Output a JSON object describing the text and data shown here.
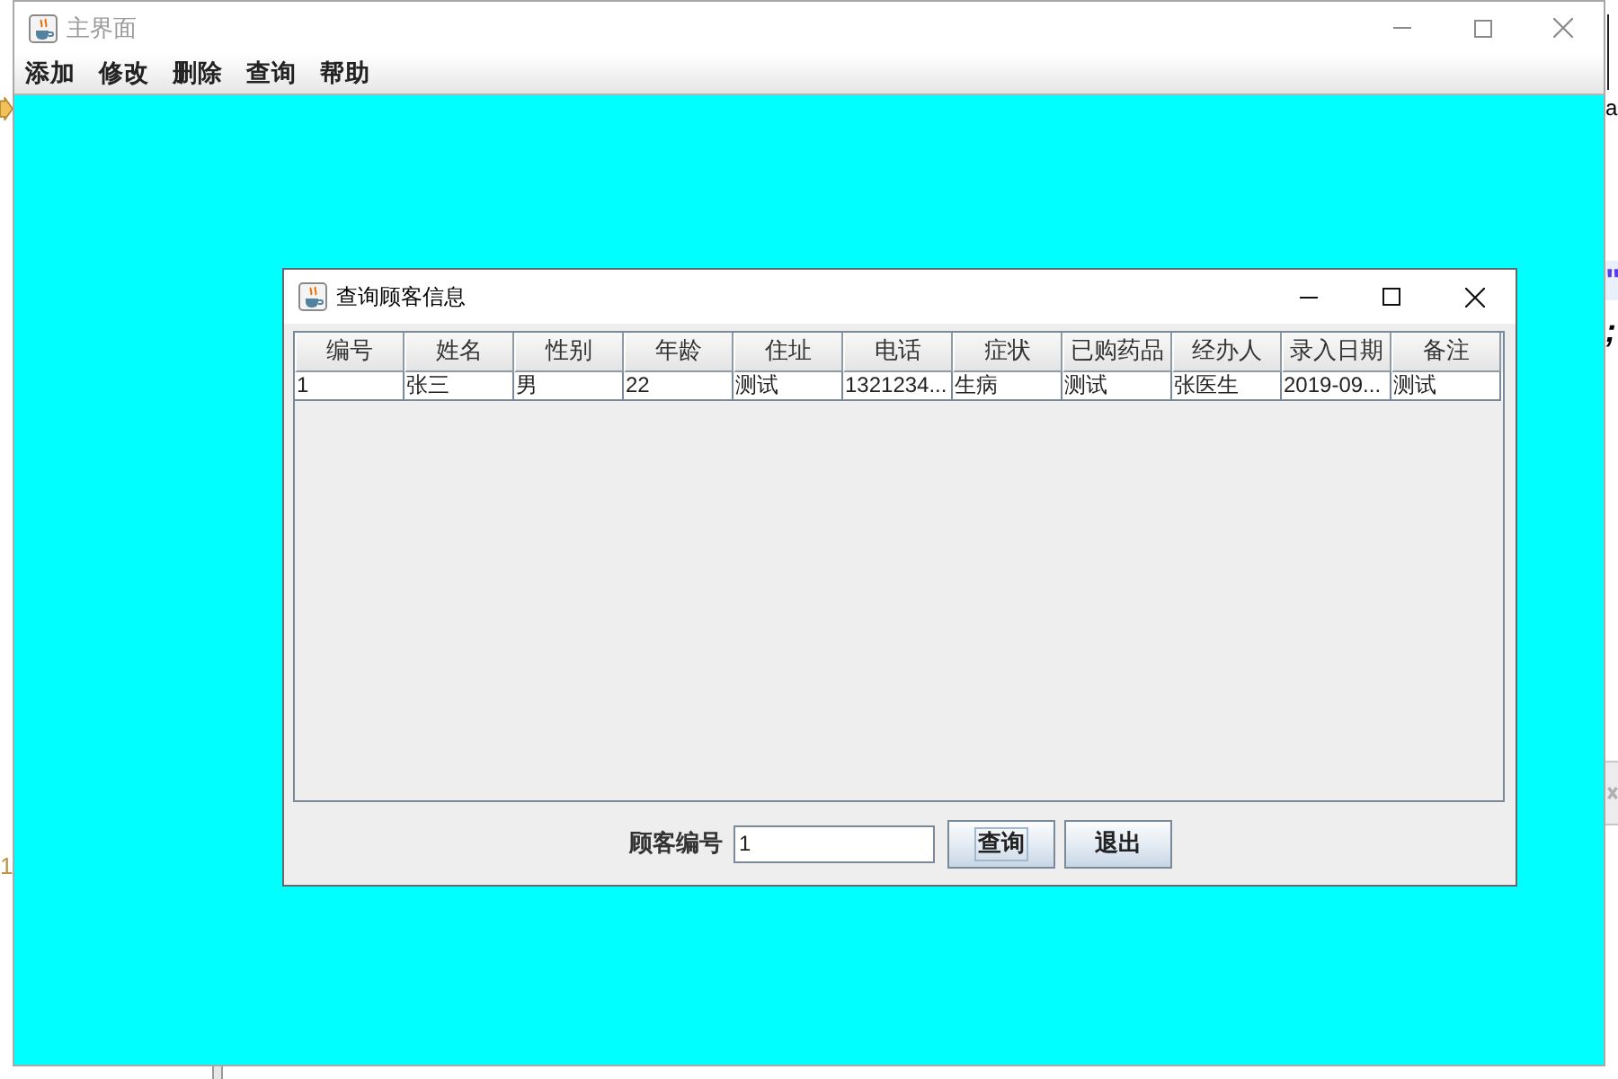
{
  "main_window": {
    "title": "主界面",
    "active": false,
    "menu": [
      {
        "label": "添加"
      },
      {
        "label": "修改"
      },
      {
        "label": "删除"
      },
      {
        "label": "查询"
      },
      {
        "label": "帮助"
      }
    ]
  },
  "dialog": {
    "title": "查询顾客信息",
    "active": true,
    "table": {
      "columns": [
        "编号",
        "姓名",
        "性别",
        "年龄",
        "住址",
        "电话",
        "症状",
        "已购药品",
        "经办人",
        "录入日期",
        "备注"
      ],
      "rows": [
        {
          "cells": [
            "1",
            "张三",
            "男",
            "22",
            "测试",
            "1321234...",
            "生病",
            "测试",
            "张医生",
            "2019-09...",
            "测试"
          ],
          "selected": false
        }
      ]
    },
    "search": {
      "label": "顾客编号",
      "value": "1"
    },
    "buttons": [
      {
        "label": "查询",
        "focused": true
      },
      {
        "label": "退出",
        "focused": false
      }
    ]
  },
  "background": {
    "fragments": [
      "a",
      "\"",
      ";",
      "1"
    ]
  }
}
